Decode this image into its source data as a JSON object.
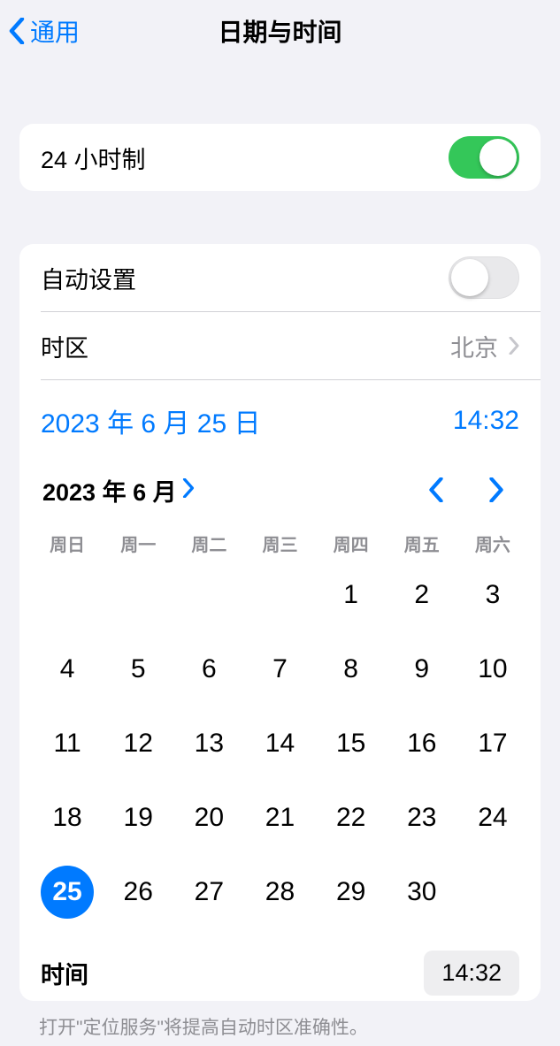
{
  "header": {
    "back": "通用",
    "title": "日期与时间"
  },
  "group1": {
    "label24h": "24 小时制"
  },
  "group2": {
    "auto": "自动设置",
    "tz_label": "时区",
    "tz_value": "北京",
    "date_display": "2023 年 6 月 25 日",
    "time_display": "14:32"
  },
  "calendar": {
    "month_title": "2023 年 6 月",
    "weekdays": [
      "周日",
      "周一",
      "周二",
      "周三",
      "周四",
      "周五",
      "周六"
    ],
    "leading_blanks": 4,
    "days_in_month": 30,
    "selected_day": 25
  },
  "time_picker": {
    "label": "时间",
    "value": "14:32"
  },
  "footer": "打开\"定位服务\"将提高自动时区准确性。"
}
